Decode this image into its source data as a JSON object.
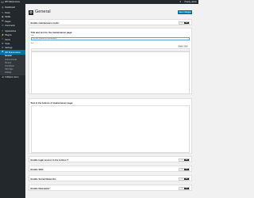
{
  "adminbar": {
    "site_name": "WP Maintenance",
    "notifications": "0",
    "howdy": "Howdy, admin"
  },
  "sidebar": {
    "items": [
      {
        "label": "Dashboard",
        "icon": "dashboard-icon"
      },
      {
        "label": "Posts",
        "icon": "pin-icon"
      },
      {
        "label": "Media",
        "icon": "media-icon"
      },
      {
        "label": "Pages",
        "icon": "page-icon"
      },
      {
        "label": "Comments",
        "icon": "comment-icon"
      },
      {
        "label": "Appearance",
        "icon": "brush-icon"
      },
      {
        "label": "Plugins",
        "icon": "plugin-icon"
      },
      {
        "label": "Users",
        "icon": "user-icon"
      },
      {
        "label": "Tools",
        "icon": "wrench-icon"
      },
      {
        "label": "Settings",
        "icon": "settings-icon"
      },
      {
        "label": "WP Maintenance",
        "icon": "gear-icon"
      }
    ],
    "submenu": [
      "General",
      "Colors & Fonts",
      "Pictures",
      "CountDown",
      "CSS Style",
      "Settings"
    ],
    "collapse": "Collapse menu"
  },
  "header": {
    "title": "General",
    "save_label": "Save Changes"
  },
  "fields": {
    "enable_maintenance": "Enable maintenance mode:",
    "title_text": "Title and text for the maintenance page:",
    "title_label": "Title",
    "title_value": "This site is down for maintenance",
    "text_label": "Text",
    "visual_tab": "Visual",
    "text_tab": "Text",
    "footer_text": "Text in the bottom of maintenance page:",
    "enable_login": "Enable login access in the bottom ?",
    "enable_seo": "Enable SEO:",
    "enable_social": "Enable Social Networks:",
    "enable_newsletter": "Enable Newsletter:"
  },
  "toggle": {
    "on": "On",
    "off": "No"
  }
}
